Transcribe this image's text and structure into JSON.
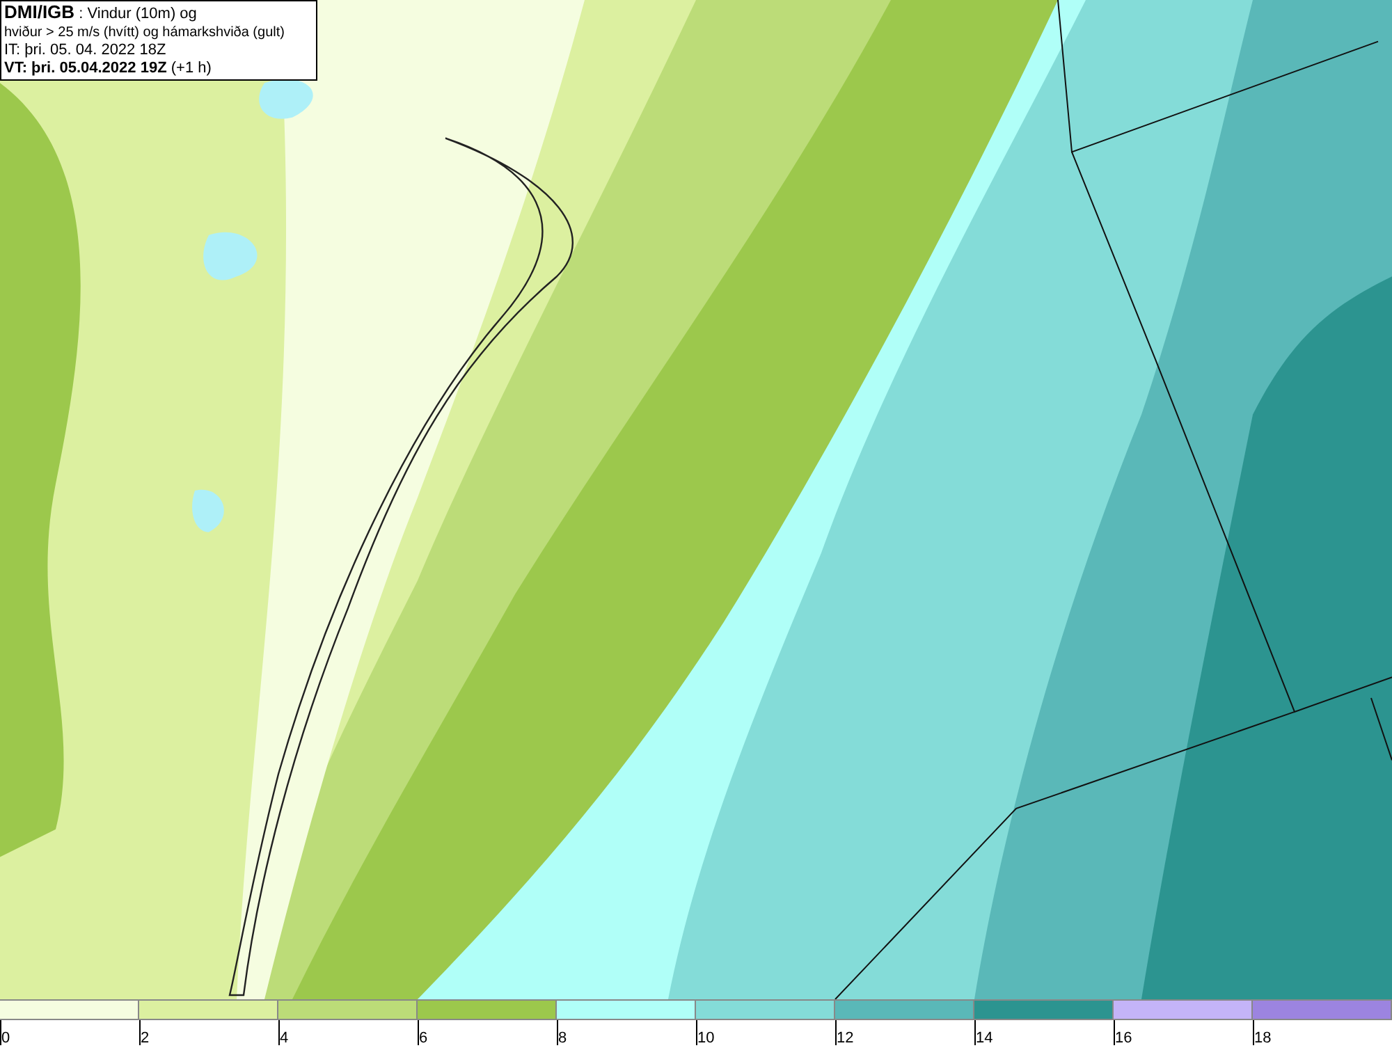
{
  "title_box": {
    "source": "DMI/IGB",
    "description_1": " : Vindur (10m) og",
    "description_2": "hviður > 25 m/s (hvítt) og hámarkshviða (gult)",
    "initial_time": "IT: þri. 05. 04. 2022 18Z",
    "valid_time": "VT: þri. 05.04.2022 19Z",
    "offset": " (+1 h)"
  },
  "legend": [
    {
      "label": "0",
      "color": "#f5fde0"
    },
    {
      "label": "2",
      "color": "#dcf0a0"
    },
    {
      "label": "4",
      "color": "#bcdc78"
    },
    {
      "label": "6",
      "color": "#9cc84c"
    },
    {
      "label": "8",
      "color": "#b0fff8"
    },
    {
      "label": "10",
      "color": "#84dcd8"
    },
    {
      "label": "12",
      "color": "#5ab8b8"
    },
    {
      "label": "14",
      "color": "#2c9490"
    },
    {
      "label": "16",
      "color": "#c4b4f8"
    },
    {
      "label": "18",
      "color": "#9c84e0"
    }
  ]
}
